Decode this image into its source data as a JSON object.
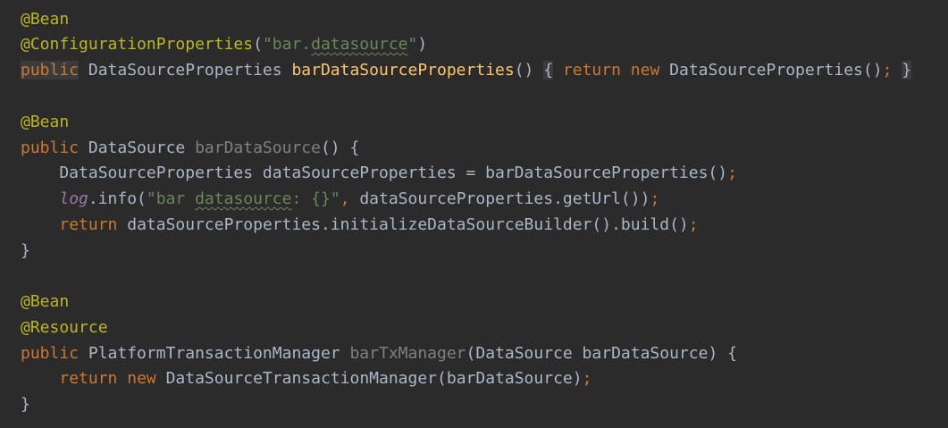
{
  "editor": {
    "background": "#2b2b2b",
    "colors": {
      "annotation": "#bbb529",
      "keyword": "#cc7832",
      "string": "#6a8759",
      "method_decl": "#ffc66d",
      "unused": "#808080",
      "static_field": "#9876aa",
      "default": "#a9b7c6"
    },
    "lines": {
      "l1_ann": "@Bean",
      "l2_ann": "@ConfigurationProperties",
      "l2_paren_open": "(",
      "l2_str_a": "\"bar.",
      "l2_str_b": "datasource",
      "l2_str_c": "\"",
      "l2_paren_close": ")",
      "l3_kw": "public",
      "l3_type": " DataSourceProperties ",
      "l3_fn": "barDataSourceProperties",
      "l3_parens": "()",
      "l3_sp": " ",
      "l3_brace_open": "{",
      "l3_sp2": " ",
      "l3_ret": "return",
      "l3_sp3": " ",
      "l3_new": "new",
      "l3_ctor": " DataSourceProperties()",
      "l3_semi": ";",
      "l3_sp4": " ",
      "l3_brace_close": "}",
      "l5_ann": "@Bean",
      "l6_kw": "public",
      "l6_type": " DataSource ",
      "l6_name": "barDataSource",
      "l6_rest": "() {",
      "l7_text": "    DataSourceProperties dataSourceProperties = barDataSourceProperties()",
      "l7_semi": ";",
      "l8_indent": "    ",
      "l8_log": "log",
      "l8_mid": ".info(",
      "l8_str_a": "\"bar ",
      "l8_str_b": "datasource",
      "l8_str_c": ": {}\"",
      "l8_comma": ",",
      "l8_rest": " dataSourceProperties.getUrl())",
      "l8_semi": ";",
      "l9_indent": "    ",
      "l9_ret": "return",
      "l9_rest": " dataSourceProperties.initializeDataSourceBuilder().build()",
      "l9_semi": ";",
      "l10_close": "}",
      "l12_ann": "@Bean",
      "l13_ann": "@Resource",
      "l14_kw": "public",
      "l14_type": " PlatformTransactionManager ",
      "l14_name": "barTxManager",
      "l14_rest": "(DataSource barDataSource) {",
      "l15_indent": "    ",
      "l15_ret": "return",
      "l15_sp": " ",
      "l15_new": "new",
      "l15_rest": " DataSourceTransactionManager(barDataSource)",
      "l15_semi": ";",
      "l16_close": "}"
    }
  }
}
